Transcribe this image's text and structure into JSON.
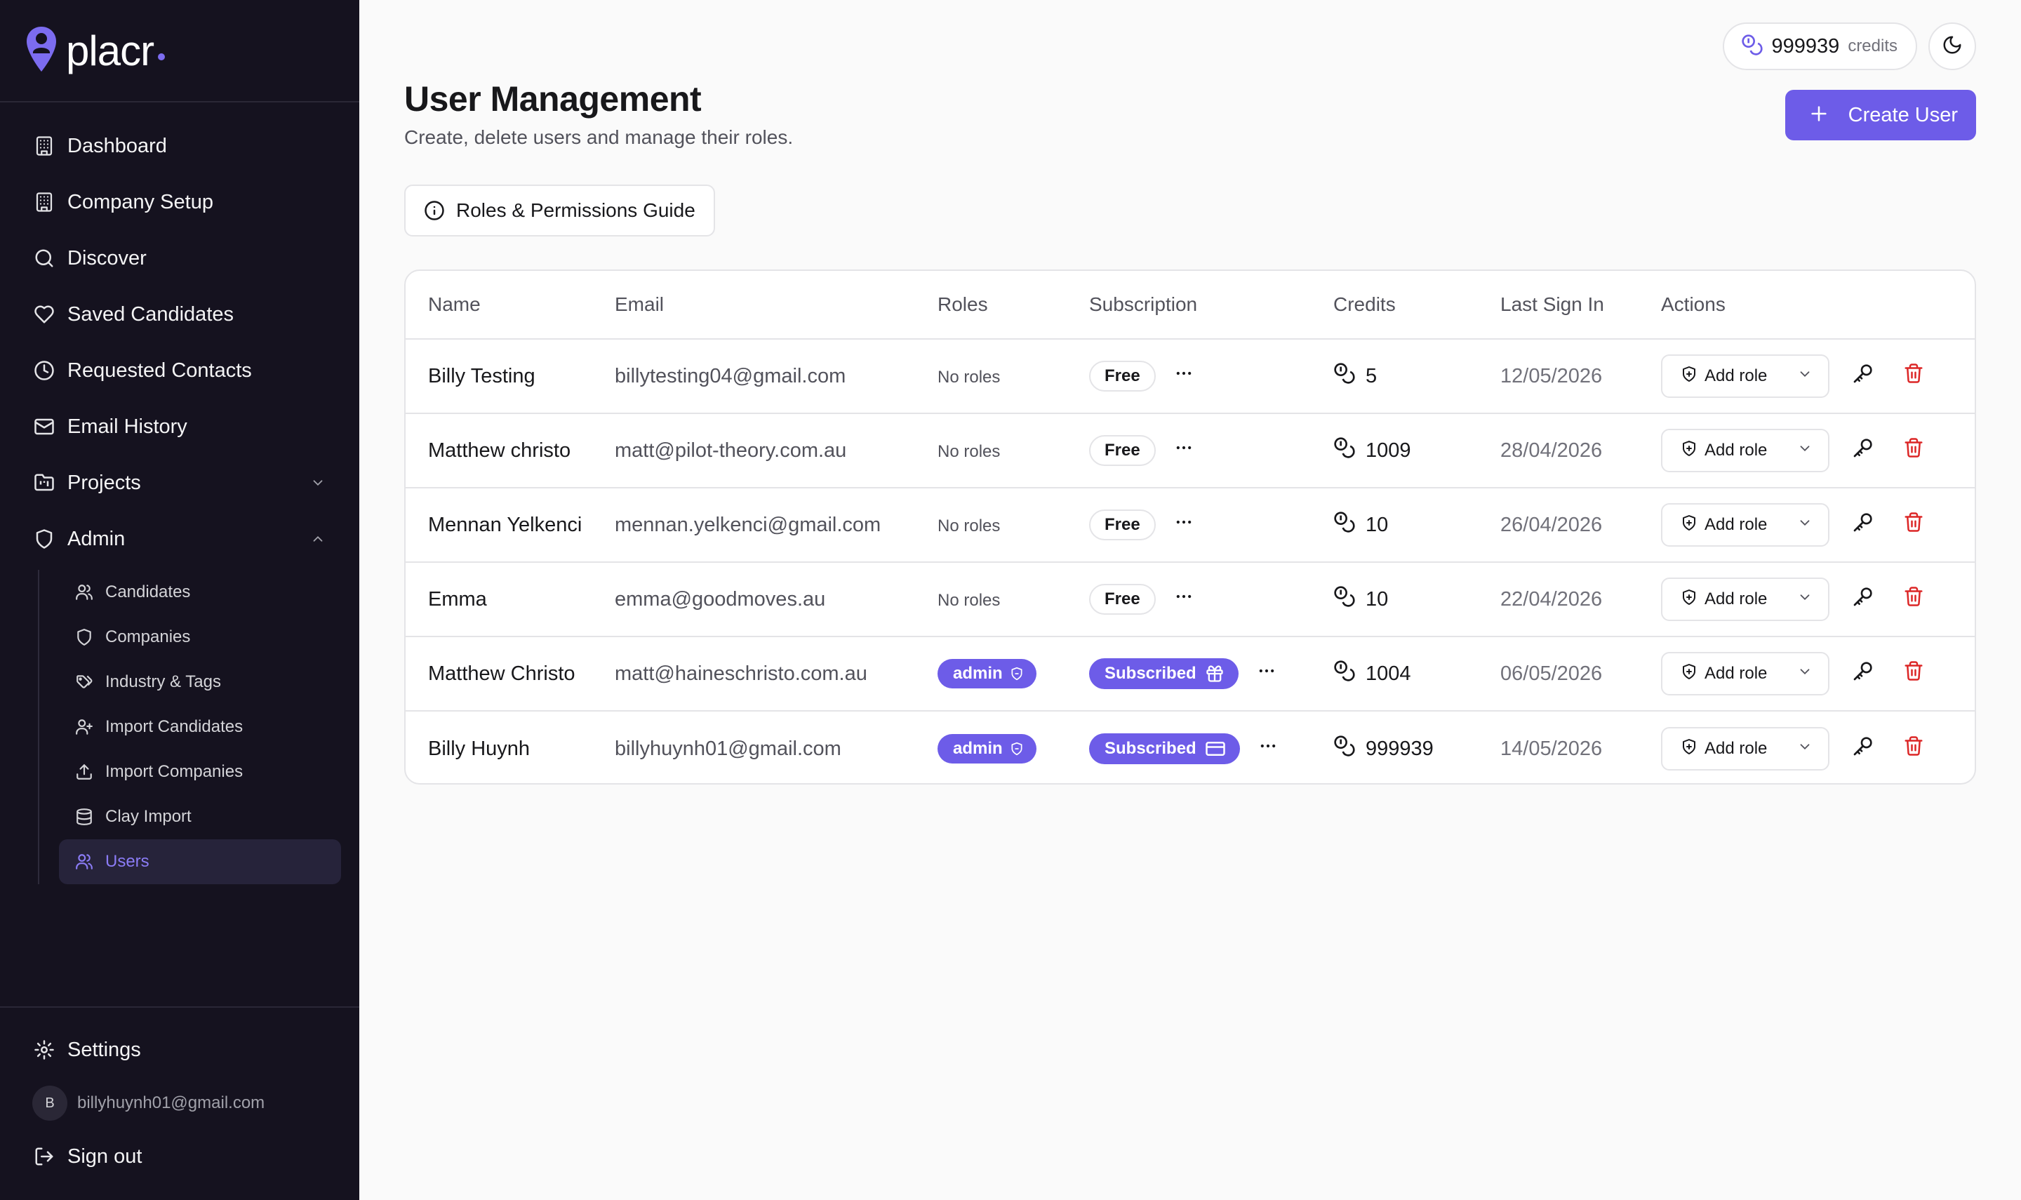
{
  "brand": {
    "name": "placr",
    "accent": "#6d5ce8",
    "logo_icon": "map-pin-person-icon"
  },
  "sidebar": {
    "items": [
      {
        "label": "Dashboard",
        "icon": "building-icon"
      },
      {
        "label": "Company Setup",
        "icon": "building-icon"
      },
      {
        "label": "Discover",
        "icon": "search-icon"
      },
      {
        "label": "Saved Candidates",
        "icon": "heart-icon"
      },
      {
        "label": "Requested Contacts",
        "icon": "clock-icon"
      },
      {
        "label": "Email History",
        "icon": "mail-icon"
      },
      {
        "label": "Projects",
        "icon": "folder-kanban-icon",
        "chevron": "chevron-down-icon"
      },
      {
        "label": "Admin",
        "icon": "shield-icon",
        "chevron": "chevron-up-icon"
      }
    ],
    "admin_items": [
      {
        "label": "Candidates",
        "icon": "users-icon"
      },
      {
        "label": "Companies",
        "icon": "shield-icon"
      },
      {
        "label": "Industry & Tags",
        "icon": "tags-icon"
      },
      {
        "label": "Import Candidates",
        "icon": "user-plus-icon"
      },
      {
        "label": "Import Companies",
        "icon": "upload-icon"
      },
      {
        "label": "Clay Import",
        "icon": "database-icon"
      },
      {
        "label": "Users",
        "icon": "users-icon",
        "active": true
      }
    ],
    "settings_label": "Settings",
    "user_initial": "B",
    "user_email": "billyhuynh01@gmail.com",
    "signout_label": "Sign out"
  },
  "header": {
    "credits_value": "999939",
    "credits_unit": "credits",
    "title": "User Management",
    "subtitle": "Create, delete users and manage their roles.",
    "create_label": "Create User",
    "guide_label": "Roles & Permissions Guide"
  },
  "table": {
    "columns": [
      "Name",
      "Email",
      "Roles",
      "Subscription",
      "Credits",
      "Last Sign In",
      "Actions"
    ],
    "rows": [
      {
        "name": "Billy Testing",
        "email": "billytesting04@gmail.com",
        "roles": "No roles",
        "subscription": "Free",
        "credits": "5",
        "last_sign_in": "12/05/2026",
        "role_action": "Add role"
      },
      {
        "name": "Matthew christo",
        "email": "matt@pilot-theory.com.au",
        "roles": "No roles",
        "subscription": "Free",
        "credits": "1009",
        "last_sign_in": "28/04/2026",
        "role_action": "Add role"
      },
      {
        "name": "Mennan Yelkenci",
        "email": "mennan.yelkenci@gmail.com",
        "roles": "No roles",
        "subscription": "Free",
        "credits": "10",
        "last_sign_in": "26/04/2026",
        "role_action": "Add role"
      },
      {
        "name": "Emma",
        "email": "emma@goodmoves.au",
        "roles": "No roles",
        "subscription": "Free",
        "credits": "10",
        "last_sign_in": "22/04/2026",
        "role_action": "Add role"
      },
      {
        "name": "Matthew Christo",
        "email": "matt@haineschristo.com.au",
        "roles": "admin",
        "subscription": "Subscribed",
        "subscription_icon": "gift-icon",
        "credits": "1004",
        "last_sign_in": "06/05/2026",
        "role_action": "Add role"
      },
      {
        "name": "Billy Huynh",
        "email": "billyhuynh01@gmail.com",
        "roles": "admin",
        "subscription": "Subscribed",
        "subscription_icon": "credit-card-icon",
        "credits": "999939",
        "last_sign_in": "14/05/2026",
        "role_action": "Add role"
      }
    ]
  }
}
